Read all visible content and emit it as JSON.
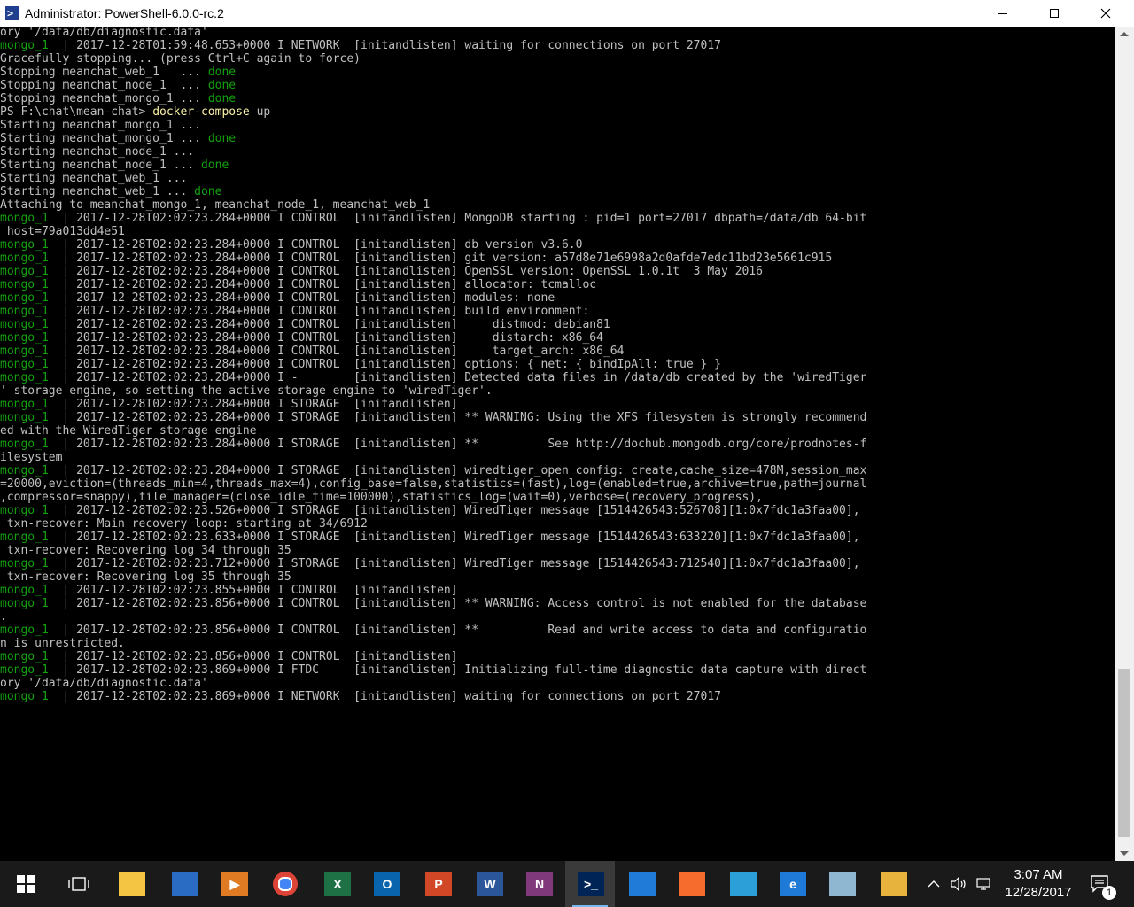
{
  "window": {
    "title": "Administrator: PowerShell-6.0.0-rc.2"
  },
  "colors": {
    "background": "#000000",
    "text": "#c0c0c0",
    "service": "#13a10e",
    "done": "#13a10e",
    "command": "#f9f1a5"
  },
  "console": {
    "lines": [
      {
        "segs": [
          {
            "t": "ory '/data/db/diagnostic.data'",
            "c": "#c0c0c0"
          }
        ]
      },
      {
        "segs": [
          {
            "t": "mongo_1",
            "c": "#13a10e"
          },
          {
            "t": "  | 2017-12-28T01:59:48.653+0000 I NETWORK  [initandlisten] waiting for connections on port 27017",
            "c": "#c0c0c0"
          }
        ]
      },
      {
        "segs": [
          {
            "t": "Gracefully stopping... (press Ctrl+C again to force)",
            "c": "#c0c0c0"
          }
        ]
      },
      {
        "segs": [
          {
            "t": "Stopping meanchat_web_1   ... ",
            "c": "#c0c0c0"
          },
          {
            "t": "done",
            "c": "#13a10e"
          }
        ]
      },
      {
        "segs": [
          {
            "t": "Stopping meanchat_node_1  ... ",
            "c": "#c0c0c0"
          },
          {
            "t": "done",
            "c": "#13a10e"
          }
        ]
      },
      {
        "segs": [
          {
            "t": "Stopping meanchat_mongo_1 ... ",
            "c": "#c0c0c0"
          },
          {
            "t": "done",
            "c": "#13a10e"
          }
        ]
      },
      {
        "segs": [
          {
            "t": "PS F:\\chat\\mean-chat> ",
            "c": "#c0c0c0"
          },
          {
            "t": "docker-compose",
            "c": "#f9f1a5"
          },
          {
            "t": " up",
            "c": "#c0c0c0"
          }
        ]
      },
      {
        "segs": [
          {
            "t": "Starting meanchat_mongo_1 ...",
            "c": "#c0c0c0"
          }
        ]
      },
      {
        "segs": [
          {
            "t": "Starting meanchat_mongo_1 ... ",
            "c": "#c0c0c0"
          },
          {
            "t": "done",
            "c": "#13a10e"
          }
        ]
      },
      {
        "segs": [
          {
            "t": "Starting meanchat_node_1 ...",
            "c": "#c0c0c0"
          }
        ]
      },
      {
        "segs": [
          {
            "t": "Starting meanchat_node_1 ... ",
            "c": "#c0c0c0"
          },
          {
            "t": "done",
            "c": "#13a10e"
          }
        ]
      },
      {
        "segs": [
          {
            "t": "Starting meanchat_web_1 ...",
            "c": "#c0c0c0"
          }
        ]
      },
      {
        "segs": [
          {
            "t": "Starting meanchat_web_1 ... ",
            "c": "#c0c0c0"
          },
          {
            "t": "done",
            "c": "#13a10e"
          }
        ]
      },
      {
        "segs": [
          {
            "t": "Attaching to meanchat_mongo_1, meanchat_node_1, meanchat_web_1",
            "c": "#c0c0c0"
          }
        ]
      },
      {
        "segs": [
          {
            "t": "mongo_1",
            "c": "#13a10e"
          },
          {
            "t": "  | 2017-12-28T02:02:23.284+0000 I CONTROL  [initandlisten] MongoDB starting : pid=1 port=27017 dbpath=/data/db 64-bit",
            "c": "#c0c0c0"
          }
        ]
      },
      {
        "segs": [
          {
            "t": " host=79a013dd4e51",
            "c": "#c0c0c0"
          }
        ]
      },
      {
        "segs": [
          {
            "t": "mongo_1",
            "c": "#13a10e"
          },
          {
            "t": "  | 2017-12-28T02:02:23.284+0000 I CONTROL  [initandlisten] db version v3.6.0",
            "c": "#c0c0c0"
          }
        ]
      },
      {
        "segs": [
          {
            "t": "mongo_1",
            "c": "#13a10e"
          },
          {
            "t": "  | 2017-12-28T02:02:23.284+0000 I CONTROL  [initandlisten] git version: a57d8e71e6998a2d0afde7edc11bd23e5661c915",
            "c": "#c0c0c0"
          }
        ]
      },
      {
        "segs": [
          {
            "t": "mongo_1",
            "c": "#13a10e"
          },
          {
            "t": "  | 2017-12-28T02:02:23.284+0000 I CONTROL  [initandlisten] OpenSSL version: OpenSSL 1.0.1t  3 May 2016",
            "c": "#c0c0c0"
          }
        ]
      },
      {
        "segs": [
          {
            "t": "mongo_1",
            "c": "#13a10e"
          },
          {
            "t": "  | 2017-12-28T02:02:23.284+0000 I CONTROL  [initandlisten] allocator: tcmalloc",
            "c": "#c0c0c0"
          }
        ]
      },
      {
        "segs": [
          {
            "t": "mongo_1",
            "c": "#13a10e"
          },
          {
            "t": "  | 2017-12-28T02:02:23.284+0000 I CONTROL  [initandlisten] modules: none",
            "c": "#c0c0c0"
          }
        ]
      },
      {
        "segs": [
          {
            "t": "mongo_1",
            "c": "#13a10e"
          },
          {
            "t": "  | 2017-12-28T02:02:23.284+0000 I CONTROL  [initandlisten] build environment:",
            "c": "#c0c0c0"
          }
        ]
      },
      {
        "segs": [
          {
            "t": "mongo_1",
            "c": "#13a10e"
          },
          {
            "t": "  | 2017-12-28T02:02:23.284+0000 I CONTROL  [initandlisten]     distmod: debian81",
            "c": "#c0c0c0"
          }
        ]
      },
      {
        "segs": [
          {
            "t": "mongo_1",
            "c": "#13a10e"
          },
          {
            "t": "  | 2017-12-28T02:02:23.284+0000 I CONTROL  [initandlisten]     distarch: x86_64",
            "c": "#c0c0c0"
          }
        ]
      },
      {
        "segs": [
          {
            "t": "mongo_1",
            "c": "#13a10e"
          },
          {
            "t": "  | 2017-12-28T02:02:23.284+0000 I CONTROL  [initandlisten]     target_arch: x86_64",
            "c": "#c0c0c0"
          }
        ]
      },
      {
        "segs": [
          {
            "t": "mongo_1",
            "c": "#13a10e"
          },
          {
            "t": "  | 2017-12-28T02:02:23.284+0000 I CONTROL  [initandlisten] options: { net: { bindIpAll: true } }",
            "c": "#c0c0c0"
          }
        ]
      },
      {
        "segs": [
          {
            "t": "mongo_1",
            "c": "#13a10e"
          },
          {
            "t": "  | 2017-12-28T02:02:23.284+0000 I -        [initandlisten] Detected data files in /data/db created by the 'wiredTiger",
            "c": "#c0c0c0"
          }
        ]
      },
      {
        "segs": [
          {
            "t": "' storage engine, so setting the active storage engine to 'wiredTiger'.",
            "c": "#c0c0c0"
          }
        ]
      },
      {
        "segs": [
          {
            "t": "mongo_1",
            "c": "#13a10e"
          },
          {
            "t": "  | 2017-12-28T02:02:23.284+0000 I STORAGE  [initandlisten]",
            "c": "#c0c0c0"
          }
        ]
      },
      {
        "segs": [
          {
            "t": "mongo_1",
            "c": "#13a10e"
          },
          {
            "t": "  | 2017-12-28T02:02:23.284+0000 I STORAGE  [initandlisten] ** WARNING: Using the XFS filesystem is strongly recommend",
            "c": "#c0c0c0"
          }
        ]
      },
      {
        "segs": [
          {
            "t": "ed with the WiredTiger storage engine",
            "c": "#c0c0c0"
          }
        ]
      },
      {
        "segs": [
          {
            "t": "mongo_1",
            "c": "#13a10e"
          },
          {
            "t": "  | 2017-12-28T02:02:23.284+0000 I STORAGE  [initandlisten] **          See http://dochub.mongodb.org/core/prodnotes-f",
            "c": "#c0c0c0"
          }
        ]
      },
      {
        "segs": [
          {
            "t": "ilesystem",
            "c": "#c0c0c0"
          }
        ]
      },
      {
        "segs": [
          {
            "t": "mongo_1",
            "c": "#13a10e"
          },
          {
            "t": "  | 2017-12-28T02:02:23.284+0000 I STORAGE  [initandlisten] wiredtiger_open config: create,cache_size=478M,session_max",
            "c": "#c0c0c0"
          }
        ]
      },
      {
        "segs": [
          {
            "t": "=20000,eviction=(threads_min=4,threads_max=4),config_base=false,statistics=(fast),log=(enabled=true,archive=true,path=journal",
            "c": "#c0c0c0"
          }
        ]
      },
      {
        "segs": [
          {
            "t": ",compressor=snappy),file_manager=(close_idle_time=100000),statistics_log=(wait=0),verbose=(recovery_progress),",
            "c": "#c0c0c0"
          }
        ]
      },
      {
        "segs": [
          {
            "t": "mongo_1",
            "c": "#13a10e"
          },
          {
            "t": "  | 2017-12-28T02:02:23.526+0000 I STORAGE  [initandlisten] WiredTiger message [1514426543:526708][1:0x7fdc1a3faa00],",
            "c": "#c0c0c0"
          }
        ]
      },
      {
        "segs": [
          {
            "t": " txn-recover: Main recovery loop: starting at 34/6912",
            "c": "#c0c0c0"
          }
        ]
      },
      {
        "segs": [
          {
            "t": "mongo_1",
            "c": "#13a10e"
          },
          {
            "t": "  | 2017-12-28T02:02:23.633+0000 I STORAGE  [initandlisten] WiredTiger message [1514426543:633220][1:0x7fdc1a3faa00],",
            "c": "#c0c0c0"
          }
        ]
      },
      {
        "segs": [
          {
            "t": " txn-recover: Recovering log 34 through 35",
            "c": "#c0c0c0"
          }
        ]
      },
      {
        "segs": [
          {
            "t": "mongo_1",
            "c": "#13a10e"
          },
          {
            "t": "  | 2017-12-28T02:02:23.712+0000 I STORAGE  [initandlisten] WiredTiger message [1514426543:712540][1:0x7fdc1a3faa00],",
            "c": "#c0c0c0"
          }
        ]
      },
      {
        "segs": [
          {
            "t": " txn-recover: Recovering log 35 through 35",
            "c": "#c0c0c0"
          }
        ]
      },
      {
        "segs": [
          {
            "t": "mongo_1",
            "c": "#13a10e"
          },
          {
            "t": "  | 2017-12-28T02:02:23.855+0000 I CONTROL  [initandlisten]",
            "c": "#c0c0c0"
          }
        ]
      },
      {
        "segs": [
          {
            "t": "mongo_1",
            "c": "#13a10e"
          },
          {
            "t": "  | 2017-12-28T02:02:23.856+0000 I CONTROL  [initandlisten] ** WARNING: Access control is not enabled for the database",
            "c": "#c0c0c0"
          }
        ]
      },
      {
        "segs": [
          {
            "t": ".",
            "c": "#c0c0c0"
          }
        ]
      },
      {
        "segs": [
          {
            "t": "mongo_1",
            "c": "#13a10e"
          },
          {
            "t": "  | 2017-12-28T02:02:23.856+0000 I CONTROL  [initandlisten] **          Read and write access to data and configuratio",
            "c": "#c0c0c0"
          }
        ]
      },
      {
        "segs": [
          {
            "t": "n is unrestricted.",
            "c": "#c0c0c0"
          }
        ]
      },
      {
        "segs": [
          {
            "t": "mongo_1",
            "c": "#13a10e"
          },
          {
            "t": "  | 2017-12-28T02:02:23.856+0000 I CONTROL  [initandlisten]",
            "c": "#c0c0c0"
          }
        ]
      },
      {
        "segs": [
          {
            "t": "mongo_1",
            "c": "#13a10e"
          },
          {
            "t": "  | 2017-12-28T02:02:23.869+0000 I FTDC     [initandlisten] Initializing full-time diagnostic data capture with direct",
            "c": "#c0c0c0"
          }
        ]
      },
      {
        "segs": [
          {
            "t": "ory '/data/db/diagnostic.data'",
            "c": "#c0c0c0"
          }
        ]
      },
      {
        "segs": [
          {
            "t": "mongo_1",
            "c": "#13a10e"
          },
          {
            "t": "  | 2017-12-28T02:02:23.869+0000 I NETWORK  [initandlisten] waiting for connections on port 27017",
            "c": "#c0c0c0"
          }
        ]
      }
    ]
  },
  "taskbar": {
    "apps": [
      {
        "name": "start-button",
        "glyph": "",
        "bg": "transparent",
        "active": false
      },
      {
        "name": "task-view-button",
        "glyph": "",
        "bg": "transparent",
        "active": false
      },
      {
        "name": "file-explorer-icon",
        "glyph": "",
        "bg": "#f4c542",
        "active": false
      },
      {
        "name": "store-icon",
        "glyph": "",
        "bg": "#2a6cc4",
        "active": false
      },
      {
        "name": "media-player-icon",
        "glyph": "▶",
        "bg": "#e07b24",
        "active": false
      },
      {
        "name": "chrome-icon",
        "glyph": "",
        "bg": "#db4437",
        "active": false
      },
      {
        "name": "excel-icon",
        "glyph": "X",
        "bg": "#1e7145",
        "active": false
      },
      {
        "name": "outlook-icon",
        "glyph": "O",
        "bg": "#0a64ad",
        "active": false
      },
      {
        "name": "powerpoint-icon",
        "glyph": "P",
        "bg": "#d24726",
        "active": false
      },
      {
        "name": "word-icon",
        "glyph": "W",
        "bg": "#2b579a",
        "active": false
      },
      {
        "name": "onenote-icon",
        "glyph": "N",
        "bg": "#80397b",
        "active": false
      },
      {
        "name": "powershell-icon",
        "glyph": ">_",
        "bg": "#012456",
        "active": true
      },
      {
        "name": "vscode-icon",
        "glyph": "",
        "bg": "#1f7ad8",
        "active": false
      },
      {
        "name": "origin-icon",
        "glyph": "",
        "bg": "#f56c2d",
        "active": false
      },
      {
        "name": "building-app-icon",
        "glyph": "",
        "bg": "#2d9fd8",
        "active": false
      },
      {
        "name": "edge-icon",
        "glyph": "e",
        "bg": "#1e7ad6",
        "active": false
      },
      {
        "name": "notepad-icon",
        "glyph": "",
        "bg": "#8fb7d1",
        "active": false
      },
      {
        "name": "git-icon",
        "glyph": "",
        "bg": "#e8b33c",
        "active": false
      }
    ],
    "time": "3:07 AM",
    "date": "12/28/2017",
    "notifications_count": "1"
  }
}
